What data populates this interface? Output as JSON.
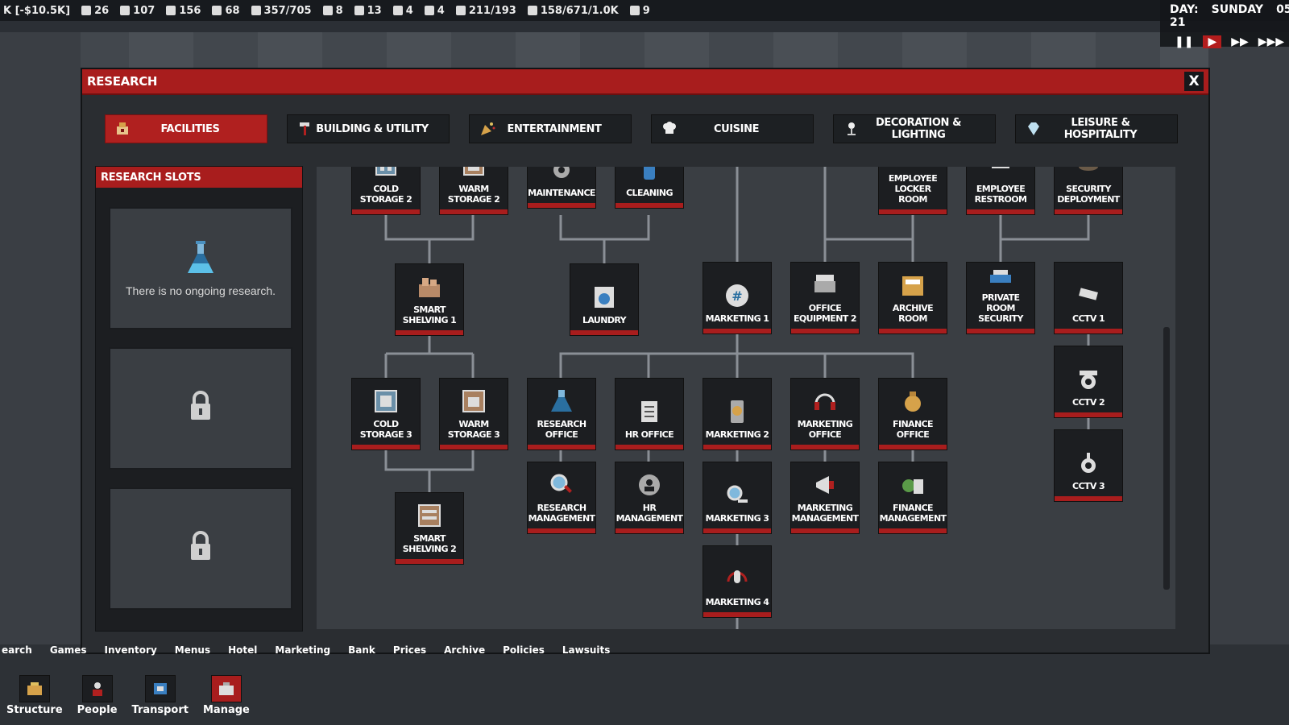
{
  "hud": {
    "money": "K [-$10.5K]",
    "stats": [
      "26",
      "107",
      "156",
      "68",
      "357/705",
      "8",
      "13",
      "4",
      "4",
      "211/193",
      "158/671/1.0K",
      "9"
    ]
  },
  "clock": {
    "day": "DAY: 21",
    "weekday": "SUNDAY",
    "extra": "05",
    "controls": [
      "❚❚",
      "▶",
      "▶▶",
      "▶▶▶"
    ]
  },
  "modal": {
    "title": "RESEARCH",
    "close_label": "X"
  },
  "tabs": [
    {
      "label": "FACILITIES",
      "icon": "facilities-icon",
      "active": true
    },
    {
      "label": "BUILDING & UTILITY",
      "icon": "hammer-icon"
    },
    {
      "label": "ENTERTAINMENT",
      "icon": "confetti-icon"
    },
    {
      "label": "CUISINE",
      "icon": "chef-hat-icon"
    },
    {
      "label": "DECORATION & LIGHTING",
      "icon": "lamp-icon"
    },
    {
      "label": "LEISURE & HOSPITALITY",
      "icon": "diamond-icon"
    }
  ],
  "slots": {
    "header": "RESEARCH SLOTS",
    "empty_text": "There is no ongoing research."
  },
  "nodes": {
    "cold_storage_2": "COLD STORAGE 2",
    "warm_storage_2": "WARM STORAGE 2",
    "maintenance": "MAINTENANCE",
    "cleaning": "CLEANING",
    "employee_locker_room": "EMPLOYEE LOCKER ROOM",
    "employee_restroom": "EMPLOYEE RESTROOM",
    "security_deployment": "SECURITY DEPLOYMENT",
    "smart_shelving_1": "SMART SHELVING 1",
    "laundry": "LAUNDRY",
    "marketing_1": "MARKETING 1",
    "office_equipment_2": "OFFICE EQUIPMENT 2",
    "archive_room": "ARCHIVE ROOM",
    "private_room_security": "PRIVATE ROOM SECURITY",
    "cctv_1": "CCTV 1",
    "cctv_2": "CCTV 2",
    "cctv_3": "CCTV 3",
    "cold_storage_3": "COLD STORAGE 3",
    "warm_storage_3": "WARM STORAGE 3",
    "research_office": "RESEARCH OFFICE",
    "hr_office": "HR OFFICE",
    "marketing_2": "MARKETING 2",
    "marketing_office": "MARKETING OFFICE",
    "finance_office": "FINANCE OFFICE",
    "research_management": "RESEARCH MANAGEMENT",
    "hr_management": "HR MANAGEMENT",
    "marketing_3": "MARKETING 3",
    "marketing_management": "MARKETING MANAGEMENT",
    "finance_management": "FINANCE MANAGEMENT",
    "smart_shelving_2": "SMART SHELVING 2",
    "marketing_4": "MARKETING 4"
  },
  "bottom_menu": [
    "earch",
    "Games",
    "Inventory",
    "Menus",
    "Hotel",
    "Marketing",
    "Bank",
    "Prices",
    "Archive",
    "Policies",
    "Lawsuits"
  ],
  "bottom_buttons": [
    "Structure",
    "People",
    "Transport",
    "Manage"
  ],
  "colors": {
    "accent": "#a81d1d",
    "panel": "#2a2d31",
    "node": "#1c1e21",
    "tree_bg": "#3a3e43"
  }
}
